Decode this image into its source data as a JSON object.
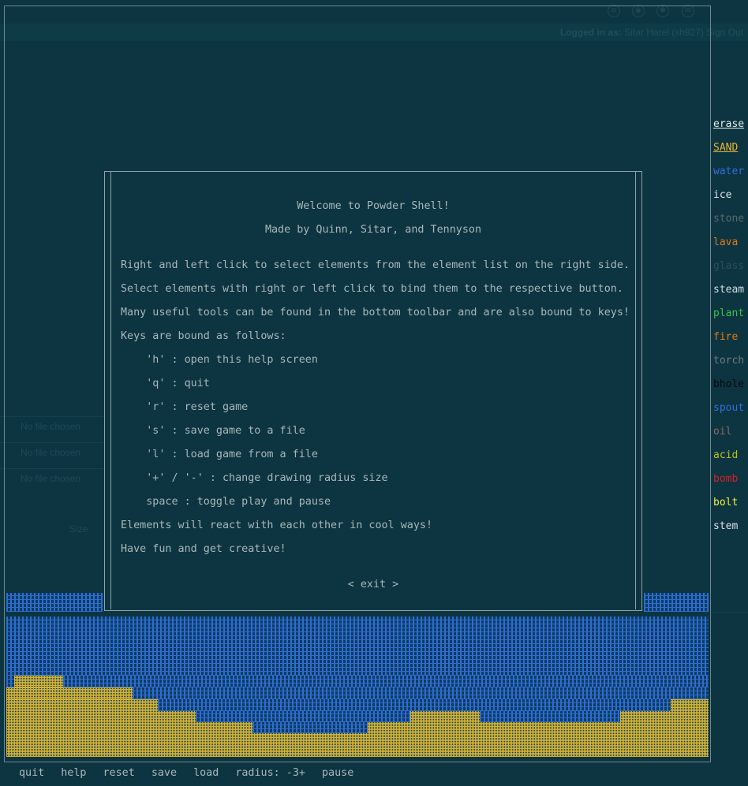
{
  "background_page": {
    "login_label": "Logged in as:",
    "login_user": "Sitar Harel (sh927)",
    "sign_out": "Sign Out",
    "file_inputs": [
      "No file chosen",
      "No file chosen",
      "No file chosen"
    ],
    "size_label": "Size"
  },
  "elements": [
    {
      "label": "erase",
      "color": "#e4e9ea",
      "selected": true
    },
    {
      "label": "SAND",
      "color": "#e5b532",
      "selected": true
    },
    {
      "label": "water",
      "color": "#2f6fe0",
      "selected": false
    },
    {
      "label": "ice",
      "color": "#d7e1e3",
      "selected": false
    },
    {
      "label": "stone",
      "color": "#5a6a6e",
      "selected": false
    },
    {
      "label": "lava",
      "color": "#e07a17",
      "selected": false
    },
    {
      "label": "glass",
      "color": "#2c4e57",
      "selected": false
    },
    {
      "label": "steam",
      "color": "#d2dcde",
      "selected": false
    },
    {
      "label": "plant",
      "color": "#39c24a",
      "selected": false
    },
    {
      "label": "fire",
      "color": "#e07a17",
      "selected": false
    },
    {
      "label": "torch",
      "color": "#6f7c7f",
      "selected": false
    },
    {
      "label": "bhole",
      "color": "#0a0a0a",
      "selected": false
    },
    {
      "label": "spout",
      "color": "#2f6fe0",
      "selected": false
    },
    {
      "label": "oil",
      "color": "#8a6a66",
      "selected": false
    },
    {
      "label": "acid",
      "color": "#b9c419",
      "selected": false
    },
    {
      "label": "bomb",
      "color": "#d02323",
      "selected": false
    },
    {
      "label": "bolt",
      "color": "#f0f236",
      "selected": false
    },
    {
      "label": "stem",
      "color": "#d7e1e3",
      "selected": false
    }
  ],
  "dialog": {
    "title": "Welcome to Powder Shell!",
    "credits": "Made by Quinn, Sitar, and Tennyson",
    "lines": [
      "Right and left click to select elements from the element list on the right side.",
      "Select elements with right or left click to bind them to the respective button.",
      "Many useful tools can be found in the bottom toolbar and are also bound to keys!",
      "Keys are bound as follows:",
      "    'h' : open this help screen",
      "    'q' : quit",
      "    'r' : reset game",
      "    's' : save game to a file",
      "    'l' : load game from a file",
      "    '+' / '-' : change drawing radius size",
      "    space : toggle play and pause",
      "Elements will react with each other in cool ways!",
      "Have fun and get creative!"
    ],
    "exit_label": "< exit >"
  },
  "toolbar": {
    "items": [
      "quit",
      "help",
      "reset",
      "save",
      "load",
      "radius: -3+",
      "pause"
    ]
  },
  "colors": {
    "background": "#0d3441",
    "water": "#2c6cd6",
    "sand": "#d6b437"
  }
}
